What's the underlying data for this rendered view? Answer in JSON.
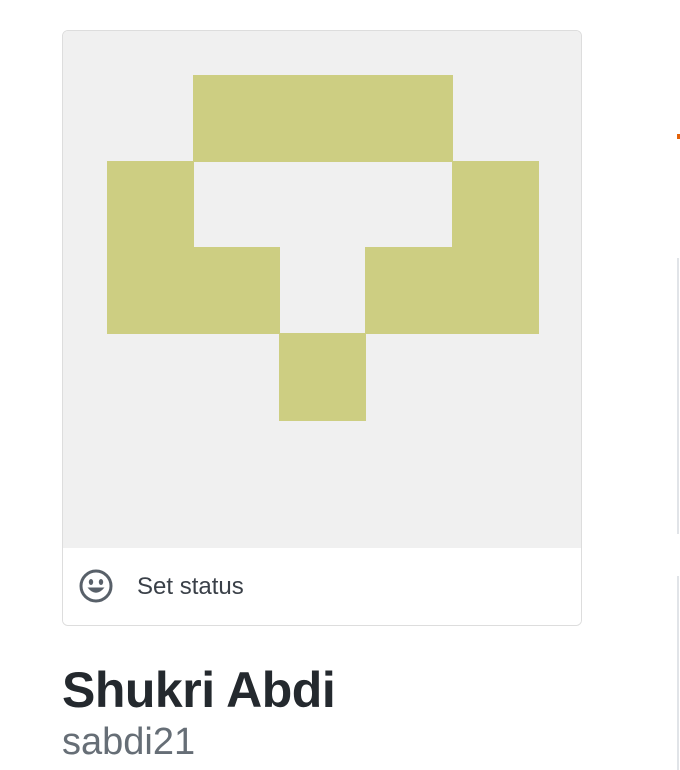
{
  "profile": {
    "full_name": "Shukri Abdi",
    "username": "sabdi21",
    "avatar": {
      "icon": "identicon",
      "foreground_color": "#cdce82",
      "background_color": "#f0f0f0"
    },
    "status": {
      "label": "Set status",
      "icon": "smiley-icon"
    }
  },
  "colors": {
    "name_text": "#24292e",
    "username_text": "#666e76",
    "status_text": "#3a4048",
    "card_border": "#dddddd"
  }
}
